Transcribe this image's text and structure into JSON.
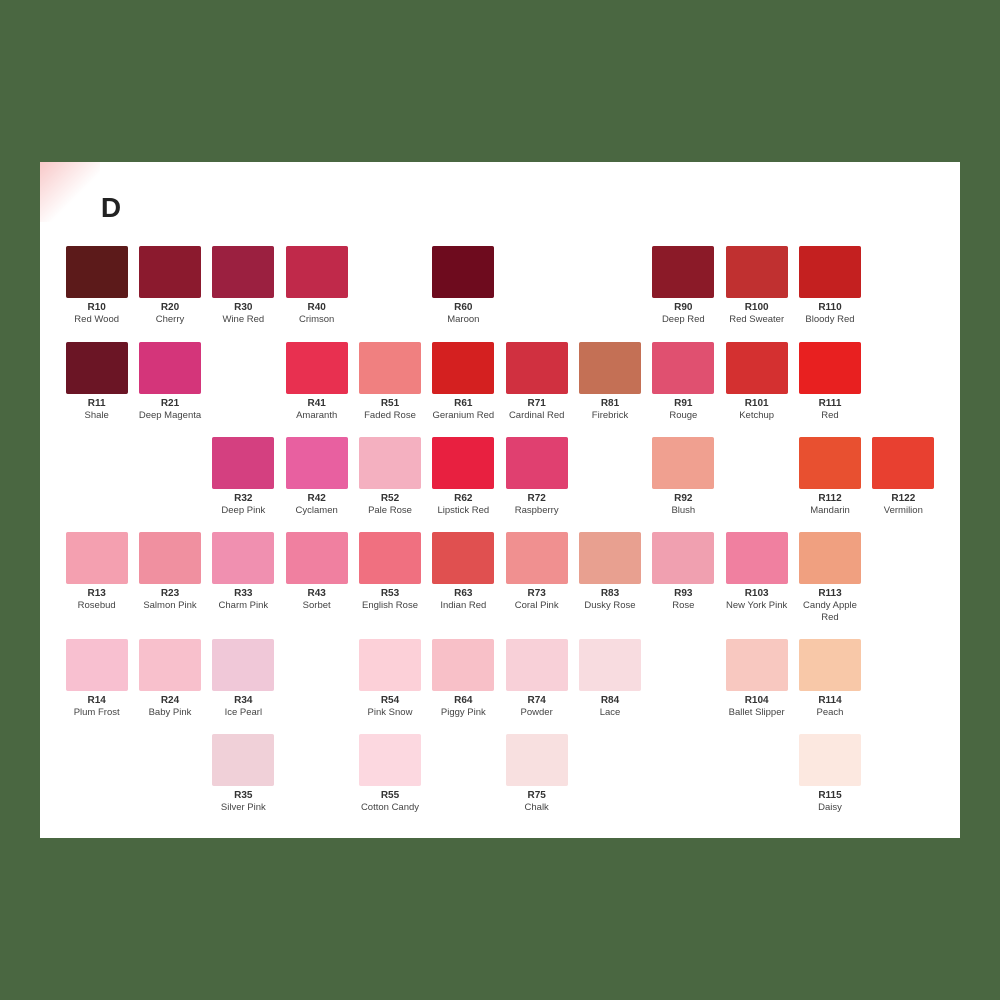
{
  "page": {
    "title": "RED",
    "background_color": "#4a6741",
    "card_bg": "#ffffff"
  },
  "colors": [
    {
      "code": "R10",
      "name": "Red Wood",
      "hex": "#5c1a1a",
      "col": 1,
      "row": 1
    },
    {
      "code": "R20",
      "name": "Cherry",
      "hex": "#8b1a2e",
      "col": 2,
      "row": 1
    },
    {
      "code": "R30",
      "name": "Wine Red",
      "hex": "#9b2040",
      "col": 3,
      "row": 1
    },
    {
      "code": "R40",
      "name": "Crimson",
      "hex": "#c0294a",
      "col": 4,
      "row": 1
    },
    {
      "code": "R60",
      "name": "Maroon",
      "hex": "#6e0b1e",
      "col": 6,
      "row": 1
    },
    {
      "code": "R90",
      "name": "Deep Red",
      "hex": "#8b1a28",
      "col": 9,
      "row": 1
    },
    {
      "code": "R100",
      "name": "Red Sweater",
      "hex": "#c03030",
      "col": 10,
      "row": 1
    },
    {
      "code": "R110",
      "name": "Bloody Red",
      "hex": "#c42020",
      "col": 11,
      "row": 1
    },
    {
      "code": "R11",
      "name": "Shale",
      "hex": "#6b1525",
      "col": 1,
      "row": 2
    },
    {
      "code": "R21",
      "name": "Deep Magenta",
      "hex": "#d4357a",
      "col": 2,
      "row": 2
    },
    {
      "code": "R41",
      "name": "Amaranth",
      "hex": "#e83050",
      "col": 4,
      "row": 2
    },
    {
      "code": "R51",
      "name": "Faded Rose",
      "hex": "#f08080",
      "col": 5,
      "row": 2
    },
    {
      "code": "R61",
      "name": "Geranium Red",
      "hex": "#d42020",
      "col": 6,
      "row": 2
    },
    {
      "code": "R71",
      "name": "Cardinal Red",
      "hex": "#d03040",
      "col": 7,
      "row": 2
    },
    {
      "code": "R81",
      "name": "Firebrick",
      "hex": "#c47055",
      "col": 8,
      "row": 2
    },
    {
      "code": "R91",
      "name": "Rouge",
      "hex": "#e05070",
      "col": 9,
      "row": 2
    },
    {
      "code": "R101",
      "name": "Ketchup",
      "hex": "#d43030",
      "col": 10,
      "row": 2
    },
    {
      "code": "R111",
      "name": "Red",
      "hex": "#e82020",
      "col": 11,
      "row": 2
    },
    {
      "code": "R32",
      "name": "Deep Pink",
      "hex": "#d44080",
      "col": 3,
      "row": 3
    },
    {
      "code": "R42",
      "name": "Cyclamen",
      "hex": "#e860a0",
      "col": 4,
      "row": 3
    },
    {
      "code": "R52",
      "name": "Pale Rose",
      "hex": "#f4b0c0",
      "col": 5,
      "row": 3
    },
    {
      "code": "R62",
      "name": "Lipstick Red",
      "hex": "#e82040",
      "col": 6,
      "row": 3
    },
    {
      "code": "R72",
      "name": "Raspberry",
      "hex": "#e04070",
      "col": 7,
      "row": 3
    },
    {
      "code": "R92",
      "name": "Blush",
      "hex": "#f0a090",
      "col": 9,
      "row": 3
    },
    {
      "code": "R112",
      "name": "Mandarin",
      "hex": "#e85030",
      "col": 11,
      "row": 3
    },
    {
      "code": "R122",
      "name": "Vermilion",
      "hex": "#e84030",
      "col": 12,
      "row": 3
    },
    {
      "code": "R13",
      "name": "Rosebud",
      "hex": "#f4a0b0",
      "col": 1,
      "row": 4
    },
    {
      "code": "R23",
      "name": "Salmon Pink",
      "hex": "#f090a0",
      "col": 2,
      "row": 4
    },
    {
      "code": "R33",
      "name": "Charm Pink",
      "hex": "#f090b0",
      "col": 3,
      "row": 4
    },
    {
      "code": "R43",
      "name": "Sorbet",
      "hex": "#f080a0",
      "col": 4,
      "row": 4
    },
    {
      "code": "R53",
      "name": "English Rose",
      "hex": "#f07080",
      "col": 5,
      "row": 4
    },
    {
      "code": "R63",
      "name": "Indian Red",
      "hex": "#e05050",
      "col": 6,
      "row": 4
    },
    {
      "code": "R73",
      "name": "Coral Pink",
      "hex": "#f09090",
      "col": 7,
      "row": 4
    },
    {
      "code": "R83",
      "name": "Dusky Rose",
      "hex": "#e8a090",
      "col": 8,
      "row": 4
    },
    {
      "code": "R93",
      "name": "Rose",
      "hex": "#f0a0b0",
      "col": 9,
      "row": 4
    },
    {
      "code": "R103",
      "name": "New York Pink",
      "hex": "#f080a0",
      "col": 10,
      "row": 4
    },
    {
      "code": "R113",
      "name": "Candy Apple Red",
      "hex": "#f0a080",
      "col": 11,
      "row": 4
    },
    {
      "code": "R14",
      "name": "Plum Frost",
      "hex": "#f8c0d0",
      "col": 1,
      "row": 5
    },
    {
      "code": "R24",
      "name": "Baby Pink",
      "hex": "#f8c0cc",
      "col": 2,
      "row": 5
    },
    {
      "code": "R34",
      "name": "Ice Pearl",
      "hex": "#f0c8d8",
      "col": 3,
      "row": 5
    },
    {
      "code": "R54",
      "name": "Pink Snow",
      "hex": "#fcd0d8",
      "col": 5,
      "row": 5
    },
    {
      "code": "R64",
      "name": "Piggy Pink",
      "hex": "#f8c0c8",
      "col": 6,
      "row": 5
    },
    {
      "code": "R74",
      "name": "Powder",
      "hex": "#f8d0d8",
      "col": 7,
      "row": 5
    },
    {
      "code": "R84",
      "name": "Lace",
      "hex": "#f8dce0",
      "col": 8,
      "row": 5
    },
    {
      "code": "R104",
      "name": "Ballet Slipper",
      "hex": "#f8c8c0",
      "col": 10,
      "row": 5
    },
    {
      "code": "R114",
      "name": "Peach",
      "hex": "#f8c8a8",
      "col": 11,
      "row": 5
    },
    {
      "code": "R35",
      "name": "Silver Pink",
      "hex": "#f0d0d8",
      "col": 3,
      "row": 6
    },
    {
      "code": "R55",
      "name": "Cotton Candy",
      "hex": "#fcd8e0",
      "col": 5,
      "row": 6
    },
    {
      "code": "R75",
      "name": "Chalk",
      "hex": "#f8e0e0",
      "col": 7,
      "row": 6
    },
    {
      "code": "R115",
      "name": "Daisy",
      "hex": "#fce8e0",
      "col": 11,
      "row": 6
    }
  ]
}
